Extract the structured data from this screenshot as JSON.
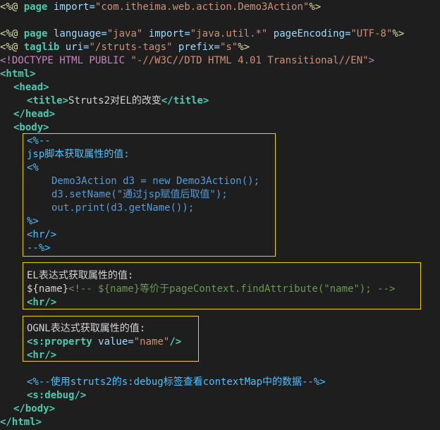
{
  "code": {
    "line1": {
      "open": "<%@",
      "directive": "page",
      "attr": "import=",
      "value": "\"com.itheima.web.action.Demo3Action\"",
      "close": "%>"
    },
    "line3": {
      "open": "<%@",
      "directive": "page",
      "attr1": "language=",
      "val1": "\"java\"",
      "attr2": "import=",
      "val2": "\"java.util.*\"",
      "attr3": "pageEncoding=",
      "val3": "\"UTF-8\"",
      "close": "%>"
    },
    "line4": {
      "open": "<%@",
      "directive": "taglib",
      "attr1": "uri=",
      "val1": "\"/struts-tags\"",
      "attr2": "prefix=",
      "val2": "\"s\"",
      "close": "%>"
    },
    "line5": {
      "doctype": "<!DOCTYPE",
      "rest": " HTML PUBLIC ",
      "value": "\"-//W3C//DTD HTML 4.01 Transitional//EN\"",
      "close": ">"
    },
    "html_open": "<html>",
    "head_open": "<head>",
    "title_open": "<title>",
    "title_text": "Struts2对EL的改变",
    "title_close": "</title>",
    "head_close": "</head>",
    "body_open": "<body>",
    "jsp_comment_open": "<%--",
    "jsp_comment_label": "jsp脚本获取属性的值:",
    "scriptlet_open": "<%",
    "java_line1": "Demo3Action d3 = new Demo3Action();",
    "java_line2": "d3.setName(\"通过jsp赋值后取值\");",
    "java_line3": "out.print(d3.getName());",
    "scriptlet_close": "%>",
    "hr_in_comment": "<hr/>",
    "jsp_comment_close": "--%>",
    "el_label": "EL表达式获取属性的值:",
    "el_expr": "${name}",
    "el_html_comment": "<!-- ${name}等价于pageContext.findAttribute(\"name\"); -->",
    "el_hr": "<hr/>",
    "ognl_label": "OGNL表达式获取属性的值:",
    "s_property_open": "<s:property",
    "s_property_attr": " value=",
    "s_property_val": "\"name\"",
    "s_property_close": "/>",
    "ognl_hr": "<hr/>",
    "debug_comment": "<%--使用struts2的s:debug标签查看contextMap中的数据--%>",
    "s_debug": "<s:debug/>",
    "body_close": "</body>",
    "html_close": "</html>"
  }
}
